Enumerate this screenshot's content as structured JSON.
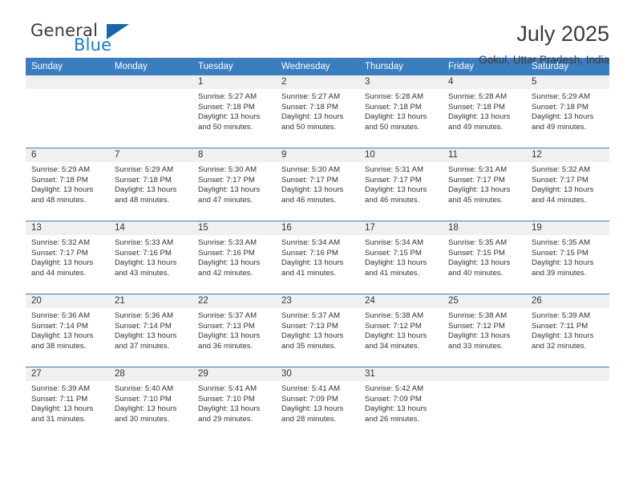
{
  "logo": {
    "word_top": "General",
    "word_bottom": "Blue",
    "triangle_color": "#1667ac",
    "blue_color": "#1a7bc4"
  },
  "header": {
    "title": "July 2025",
    "subtitle": "Gokul, Uttar Pradesh, India"
  },
  "theme": {
    "header_blue": "#3a7ebf",
    "day_band_gray": "#f0f0f0",
    "text": "#333333"
  },
  "weekday_headers": [
    "Sunday",
    "Monday",
    "Tuesday",
    "Wednesday",
    "Thursday",
    "Friday",
    "Saturday"
  ],
  "labels": {
    "sunrise_prefix": "Sunrise:",
    "sunset_prefix": "Sunset:",
    "daylight_prefix": "Daylight:"
  },
  "weeks": [
    [
      {
        "day": "",
        "sunrise": "",
        "sunset": "",
        "daylight_line1": "",
        "daylight_line2": "",
        "empty": true
      },
      {
        "day": "",
        "sunrise": "",
        "sunset": "",
        "daylight_line1": "",
        "daylight_line2": "",
        "empty": true
      },
      {
        "day": "1",
        "sunrise": "Sunrise: 5:27 AM",
        "sunset": "Sunset: 7:18 PM",
        "daylight_line1": "Daylight: 13 hours",
        "daylight_line2": "and 50 minutes.",
        "empty": false
      },
      {
        "day": "2",
        "sunrise": "Sunrise: 5:27 AM",
        "sunset": "Sunset: 7:18 PM",
        "daylight_line1": "Daylight: 13 hours",
        "daylight_line2": "and 50 minutes.",
        "empty": false
      },
      {
        "day": "3",
        "sunrise": "Sunrise: 5:28 AM",
        "sunset": "Sunset: 7:18 PM",
        "daylight_line1": "Daylight: 13 hours",
        "daylight_line2": "and 50 minutes.",
        "empty": false
      },
      {
        "day": "4",
        "sunrise": "Sunrise: 5:28 AM",
        "sunset": "Sunset: 7:18 PM",
        "daylight_line1": "Daylight: 13 hours",
        "daylight_line2": "and 49 minutes.",
        "empty": false
      },
      {
        "day": "5",
        "sunrise": "Sunrise: 5:29 AM",
        "sunset": "Sunset: 7:18 PM",
        "daylight_line1": "Daylight: 13 hours",
        "daylight_line2": "and 49 minutes.",
        "empty": false
      }
    ],
    [
      {
        "day": "6",
        "sunrise": "Sunrise: 5:29 AM",
        "sunset": "Sunset: 7:18 PM",
        "daylight_line1": "Daylight: 13 hours",
        "daylight_line2": "and 48 minutes.",
        "empty": false
      },
      {
        "day": "7",
        "sunrise": "Sunrise: 5:29 AM",
        "sunset": "Sunset: 7:18 PM",
        "daylight_line1": "Daylight: 13 hours",
        "daylight_line2": "and 48 minutes.",
        "empty": false
      },
      {
        "day": "8",
        "sunrise": "Sunrise: 5:30 AM",
        "sunset": "Sunset: 7:17 PM",
        "daylight_line1": "Daylight: 13 hours",
        "daylight_line2": "and 47 minutes.",
        "empty": false
      },
      {
        "day": "9",
        "sunrise": "Sunrise: 5:30 AM",
        "sunset": "Sunset: 7:17 PM",
        "daylight_line1": "Daylight: 13 hours",
        "daylight_line2": "and 46 minutes.",
        "empty": false
      },
      {
        "day": "10",
        "sunrise": "Sunrise: 5:31 AM",
        "sunset": "Sunset: 7:17 PM",
        "daylight_line1": "Daylight: 13 hours",
        "daylight_line2": "and 46 minutes.",
        "empty": false
      },
      {
        "day": "11",
        "sunrise": "Sunrise: 5:31 AM",
        "sunset": "Sunset: 7:17 PM",
        "daylight_line1": "Daylight: 13 hours",
        "daylight_line2": "and 45 minutes.",
        "empty": false
      },
      {
        "day": "12",
        "sunrise": "Sunrise: 5:32 AM",
        "sunset": "Sunset: 7:17 PM",
        "daylight_line1": "Daylight: 13 hours",
        "daylight_line2": "and 44 minutes.",
        "empty": false
      }
    ],
    [
      {
        "day": "13",
        "sunrise": "Sunrise: 5:32 AM",
        "sunset": "Sunset: 7:17 PM",
        "daylight_line1": "Daylight: 13 hours",
        "daylight_line2": "and 44 minutes.",
        "empty": false
      },
      {
        "day": "14",
        "sunrise": "Sunrise: 5:33 AM",
        "sunset": "Sunset: 7:16 PM",
        "daylight_line1": "Daylight: 13 hours",
        "daylight_line2": "and 43 minutes.",
        "empty": false
      },
      {
        "day": "15",
        "sunrise": "Sunrise: 5:33 AM",
        "sunset": "Sunset: 7:16 PM",
        "daylight_line1": "Daylight: 13 hours",
        "daylight_line2": "and 42 minutes.",
        "empty": false
      },
      {
        "day": "16",
        "sunrise": "Sunrise: 5:34 AM",
        "sunset": "Sunset: 7:16 PM",
        "daylight_line1": "Daylight: 13 hours",
        "daylight_line2": "and 41 minutes.",
        "empty": false
      },
      {
        "day": "17",
        "sunrise": "Sunrise: 5:34 AM",
        "sunset": "Sunset: 7:15 PM",
        "daylight_line1": "Daylight: 13 hours",
        "daylight_line2": "and 41 minutes.",
        "empty": false
      },
      {
        "day": "18",
        "sunrise": "Sunrise: 5:35 AM",
        "sunset": "Sunset: 7:15 PM",
        "daylight_line1": "Daylight: 13 hours",
        "daylight_line2": "and 40 minutes.",
        "empty": false
      },
      {
        "day": "19",
        "sunrise": "Sunrise: 5:35 AM",
        "sunset": "Sunset: 7:15 PM",
        "daylight_line1": "Daylight: 13 hours",
        "daylight_line2": "and 39 minutes.",
        "empty": false
      }
    ],
    [
      {
        "day": "20",
        "sunrise": "Sunrise: 5:36 AM",
        "sunset": "Sunset: 7:14 PM",
        "daylight_line1": "Daylight: 13 hours",
        "daylight_line2": "and 38 minutes.",
        "empty": false
      },
      {
        "day": "21",
        "sunrise": "Sunrise: 5:36 AM",
        "sunset": "Sunset: 7:14 PM",
        "daylight_line1": "Daylight: 13 hours",
        "daylight_line2": "and 37 minutes.",
        "empty": false
      },
      {
        "day": "22",
        "sunrise": "Sunrise: 5:37 AM",
        "sunset": "Sunset: 7:13 PM",
        "daylight_line1": "Daylight: 13 hours",
        "daylight_line2": "and 36 minutes.",
        "empty": false
      },
      {
        "day": "23",
        "sunrise": "Sunrise: 5:37 AM",
        "sunset": "Sunset: 7:13 PM",
        "daylight_line1": "Daylight: 13 hours",
        "daylight_line2": "and 35 minutes.",
        "empty": false
      },
      {
        "day": "24",
        "sunrise": "Sunrise: 5:38 AM",
        "sunset": "Sunset: 7:12 PM",
        "daylight_line1": "Daylight: 13 hours",
        "daylight_line2": "and 34 minutes.",
        "empty": false
      },
      {
        "day": "25",
        "sunrise": "Sunrise: 5:38 AM",
        "sunset": "Sunset: 7:12 PM",
        "daylight_line1": "Daylight: 13 hours",
        "daylight_line2": "and 33 minutes.",
        "empty": false
      },
      {
        "day": "26",
        "sunrise": "Sunrise: 5:39 AM",
        "sunset": "Sunset: 7:11 PM",
        "daylight_line1": "Daylight: 13 hours",
        "daylight_line2": "and 32 minutes.",
        "empty": false
      }
    ],
    [
      {
        "day": "27",
        "sunrise": "Sunrise: 5:39 AM",
        "sunset": "Sunset: 7:11 PM",
        "daylight_line1": "Daylight: 13 hours",
        "daylight_line2": "and 31 minutes.",
        "empty": false
      },
      {
        "day": "28",
        "sunrise": "Sunrise: 5:40 AM",
        "sunset": "Sunset: 7:10 PM",
        "daylight_line1": "Daylight: 13 hours",
        "daylight_line2": "and 30 minutes.",
        "empty": false
      },
      {
        "day": "29",
        "sunrise": "Sunrise: 5:41 AM",
        "sunset": "Sunset: 7:10 PM",
        "daylight_line1": "Daylight: 13 hours",
        "daylight_line2": "and 29 minutes.",
        "empty": false
      },
      {
        "day": "30",
        "sunrise": "Sunrise: 5:41 AM",
        "sunset": "Sunset: 7:09 PM",
        "daylight_line1": "Daylight: 13 hours",
        "daylight_line2": "and 28 minutes.",
        "empty": false
      },
      {
        "day": "31",
        "sunrise": "Sunrise: 5:42 AM",
        "sunset": "Sunset: 7:09 PM",
        "daylight_line1": "Daylight: 13 hours",
        "daylight_line2": "and 26 minutes.",
        "empty": false
      },
      {
        "day": "",
        "sunrise": "",
        "sunset": "",
        "daylight_line1": "",
        "daylight_line2": "",
        "empty": true
      },
      {
        "day": "",
        "sunrise": "",
        "sunset": "",
        "daylight_line1": "",
        "daylight_line2": "",
        "empty": true
      }
    ]
  ]
}
